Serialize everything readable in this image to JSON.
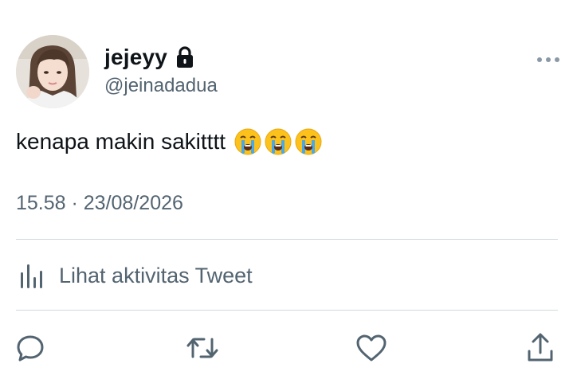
{
  "user": {
    "display_name": "jejeyy",
    "handle": "@jeinadadua",
    "protected_icon": "lock-icon",
    "avatar": "profile-photo"
  },
  "tweet": {
    "text": "kenapa makin sakitttt",
    "emojis": [
      "loudly-crying-face",
      "loudly-crying-face",
      "loudly-crying-face"
    ],
    "timestamp": "15.58 · 23/08/2026"
  },
  "activity": {
    "label": "Lihat aktivitas Tweet",
    "icon": "bar-chart-icon"
  },
  "actions": [
    {
      "name": "reply",
      "icon": "reply-icon"
    },
    {
      "name": "retweet",
      "icon": "retweet-icon"
    },
    {
      "name": "like",
      "icon": "heart-icon"
    },
    {
      "name": "share",
      "icon": "share-icon"
    }
  ],
  "colors": {
    "text_primary": "#0f1419",
    "text_secondary": "#536471",
    "divider": "#cfd9de",
    "emoji_face": "#fcc21b",
    "emoji_tears": "#4aa8e8"
  }
}
